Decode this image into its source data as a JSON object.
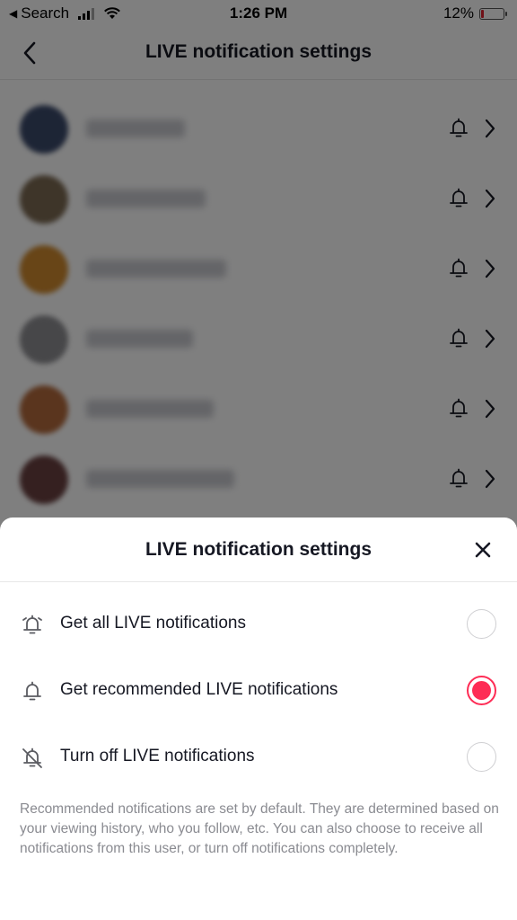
{
  "status_bar": {
    "back_app": "Search",
    "time": "1:26 PM",
    "battery_percent": "12%",
    "battery_level": 0.12,
    "battery_color": "#e0232e"
  },
  "nav": {
    "title": "LIVE notification settings",
    "back_icon": "chevron-left-icon"
  },
  "background_list": {
    "rows": [
      {
        "avatar_color": "#3b4a6b",
        "bell_icon": "bell-icon",
        "chevron_icon": "chevron-right-icon"
      },
      {
        "avatar_color": "#7c6a52",
        "bell_icon": "bell-icon",
        "chevron_icon": "chevron-right-icon"
      },
      {
        "avatar_color": "#d08a2e",
        "bell_icon": "bell-icon",
        "chevron_icon": "chevron-right-icon"
      },
      {
        "avatar_color": "#8f8f93",
        "bell_icon": "bell-icon",
        "chevron_icon": "chevron-right-icon"
      },
      {
        "avatar_color": "#b46a3c",
        "bell_icon": "bell-icon",
        "chevron_icon": "chevron-right-icon"
      },
      {
        "avatar_color": "#6a4040",
        "bell_icon": "bell-icon",
        "chevron_icon": "chevron-right-icon"
      }
    ]
  },
  "sheet": {
    "title": "LIVE notification settings",
    "close_icon": "close-icon",
    "options": [
      {
        "label": "Get all LIVE notifications",
        "icon": "bell-ringing-icon",
        "selected": false
      },
      {
        "label": "Get recommended LIVE notifications",
        "icon": "bell-icon",
        "selected": true
      },
      {
        "label": "Turn off LIVE notifications",
        "icon": "bell-off-icon",
        "selected": false
      }
    ],
    "footnote": "Recommended notifications are set by default. They are determined based on your viewing history, who you follow, etc. You can also choose to receive all notifications from this user, or turn off notifications completely.",
    "accent_color": "#fe2c55"
  }
}
